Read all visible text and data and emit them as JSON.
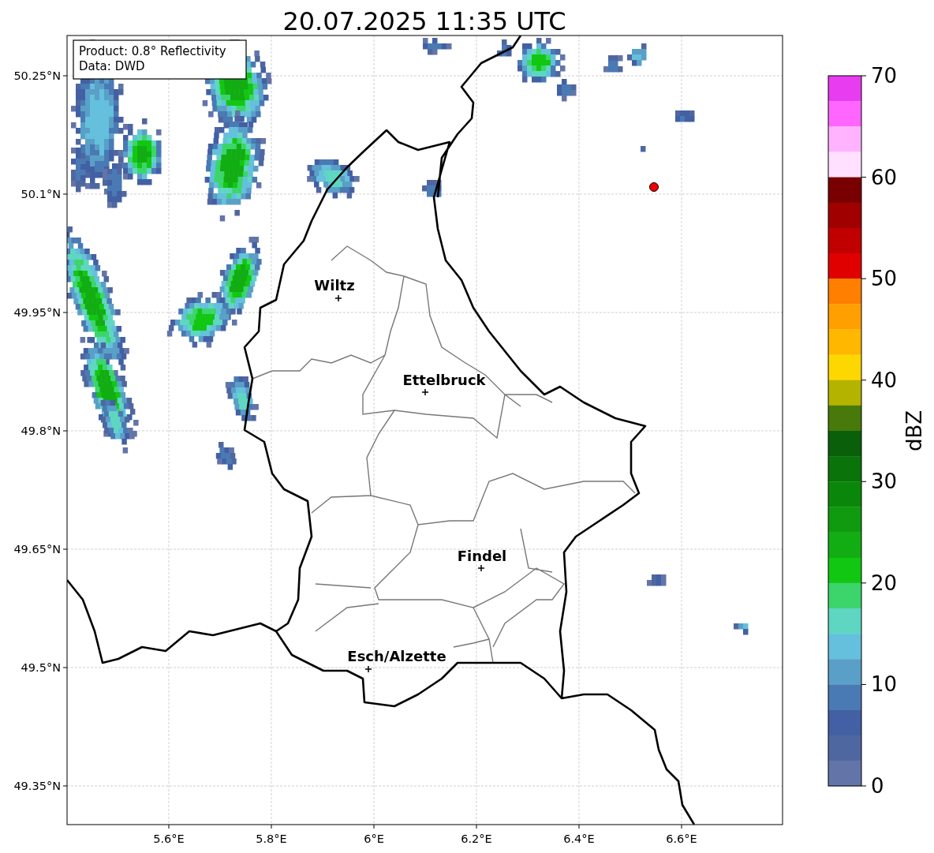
{
  "title": "20.07.2025 11:35 UTC",
  "info_box": {
    "lines": [
      "Product: 0.8° Reflectivity",
      "Data: DWD"
    ]
  },
  "map": {
    "y_ticks": [
      "50.25°N",
      "50.1°N",
      "49.95°N",
      "49.8°N",
      "49.65°N",
      "49.5°N",
      "49.35°N"
    ],
    "x_ticks": [
      "5.6°E",
      "5.8°E",
      "6°E",
      "6.2°E",
      "6.4°E",
      "6.6°E"
    ],
    "places": [
      {
        "name": "Wiltz"
      },
      {
        "name": "Ettelbruck"
      },
      {
        "name": "Findel"
      },
      {
        "name": "Esch/Alzette"
      }
    ]
  },
  "colorbar": {
    "label": "dBZ",
    "ticks": [
      "70",
      "60",
      "50",
      "40",
      "30",
      "20",
      "10",
      "0"
    ],
    "segments": [
      {
        "color": "#e83cf0"
      },
      {
        "color": "#ff66ff"
      },
      {
        "color": "#ffb3ff"
      },
      {
        "color": "#ffe0ff"
      },
      {
        "color": "#780000"
      },
      {
        "color": "#a00000"
      },
      {
        "color": "#c00000"
      },
      {
        "color": "#e00000"
      },
      {
        "color": "#ff7f00"
      },
      {
        "color": "#ff9f00"
      },
      {
        "color": "#ffb700"
      },
      {
        "color": "#ffd700"
      },
      {
        "color": "#b3b300"
      },
      {
        "color": "#477a0a"
      },
      {
        "color": "#0a5f0a"
      },
      {
        "color": "#0a740a"
      },
      {
        "color": "#0a870a"
      },
      {
        "color": "#0f9a0f"
      },
      {
        "color": "#12ad12"
      },
      {
        "color": "#12c712"
      },
      {
        "color": "#3cd56c"
      },
      {
        "color": "#5fd6c2"
      },
      {
        "color": "#64c0dc"
      },
      {
        "color": "#5a9fc8"
      },
      {
        "color": "#4a7ab3"
      },
      {
        "color": "#4260a3"
      },
      {
        "color": "#4f67a0"
      },
      {
        "color": "#6375a8"
      }
    ]
  }
}
